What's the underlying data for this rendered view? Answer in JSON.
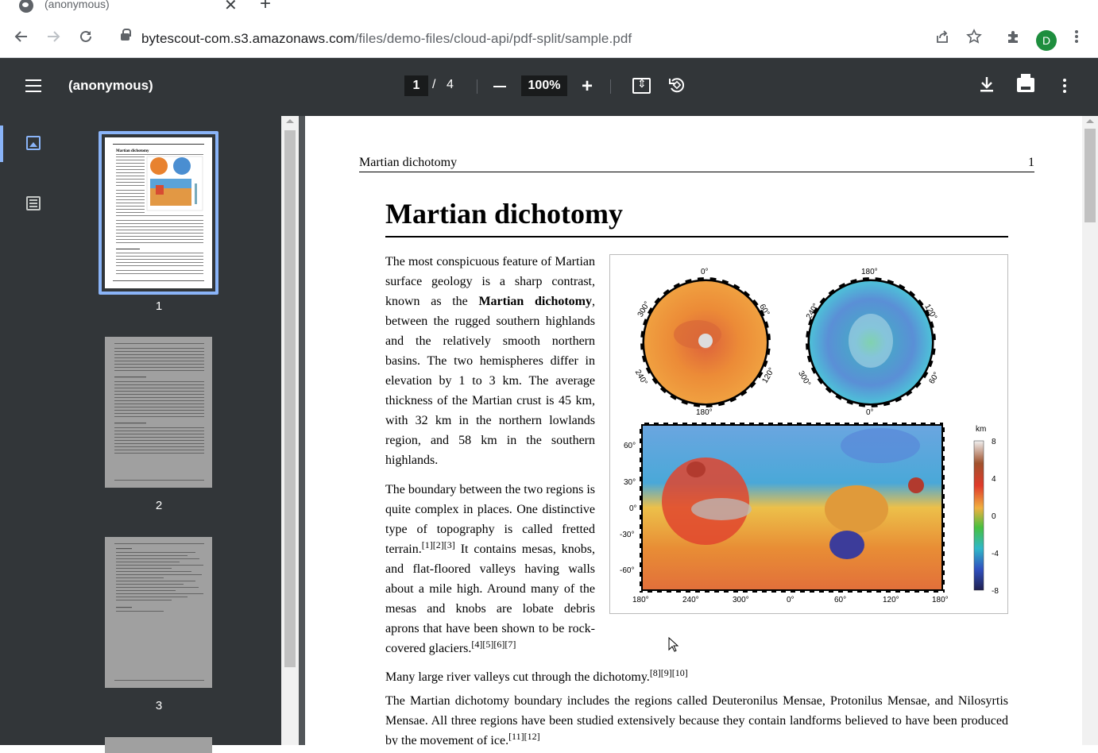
{
  "browser": {
    "tab_title": "(anonymous)",
    "tab_close": "✕",
    "new_tab": "+",
    "url_host": "bytescout-com.s3.amazonaws.com",
    "url_path": "/files/demo-files/cloud-api/pdf-split/sample.pdf",
    "profile_initial": "D"
  },
  "viewer": {
    "title": "(anonymous)",
    "current_page": "1",
    "page_separator": "/",
    "total_pages": "4",
    "zoom": "100%"
  },
  "thumbnails": [
    {
      "label": "1"
    },
    {
      "label": "2"
    },
    {
      "label": "3"
    }
  ],
  "page": {
    "running_title": "Martian dichotomy",
    "page_number": "1",
    "heading": "Martian dichotomy",
    "p1_a": "The most conspicuous feature of Martian surface geology is a sharp contrast, known as the ",
    "p1_bold": "Martian dichotomy",
    "p1_b": ", between the rugged southern highlands and the relatively smooth northern basins. The two hemispheres differ in elevation by 1 to 3 km. The average thickness of the Martian crust is 45 km, with 32 km in the northern lowlands region, and 58 km in the southern highlands.",
    "p2_a": "The boundary between the two regions is quite complex in places. One distinctive type of topography is called fretted terrain.",
    "p2_refs1": "[1][2][3]",
    "p2_b": " It contains mesas, knobs, and flat-floored valleys having walls about a mile high. Around many of the mesas and knobs are lobate debris aprons that have been shown to be rock-covered glaciers.",
    "p2_refs2": "[4][5][6][7]",
    "p3": "Many large river valleys cut through the dichotomy.",
    "p3_refs": "[8][9][10]",
    "p4": "The Martian dichotomy boundary includes the regions called Deuteronilus Mensae, Protonilus Mensae, and Nilosyrtis Mensae. All three regions have been studied extensively because they contain landforms believed to have been produced by the movement of ice.",
    "p4_refs": "[11][12]"
  },
  "figure": {
    "north_top": "0°",
    "north_left": "300°",
    "north_right": "60°",
    "north_bl": "240°",
    "north_br": "120°",
    "north_bottom": "180°",
    "south_top": "180°",
    "south_left": "240°",
    "south_right": "120°",
    "south_bl": "300°",
    "south_br": "60°",
    "south_bottom": "0°",
    "map_y": [
      "60°",
      "30°",
      "0°",
      "-30°",
      "-60°"
    ],
    "map_x": [
      "180°",
      "240°",
      "300°",
      "0°",
      "60°",
      "120°",
      "180°"
    ],
    "scale_unit": "km",
    "scale_ticks": [
      "8",
      "4",
      "0",
      "-4",
      "-8"
    ]
  }
}
